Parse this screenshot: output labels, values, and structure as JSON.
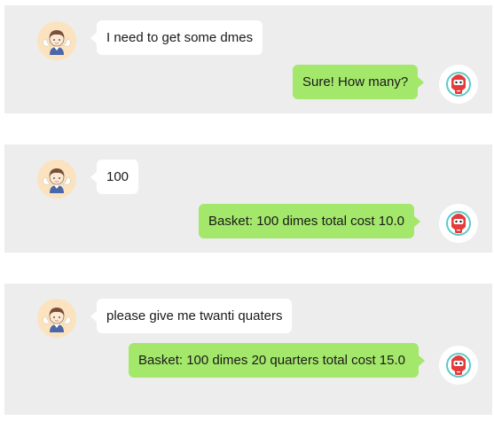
{
  "colors": {
    "panel_bg": "#ededed",
    "user_bubble": "#ffffff",
    "bot_bubble": "#a3e76b",
    "user_avatar_bg": "#fbe3bf"
  },
  "icons": {
    "user_avatar": "boy-with-wings-avatar-icon",
    "bot_avatar": "red-robot-avatar-icon"
  },
  "conversations": [
    {
      "user_message": "I need to get some dmes",
      "bot_message": "Sure! How many?"
    },
    {
      "user_message": "100",
      "bot_message": "Basket: 100 dimes total cost 10.0"
    },
    {
      "user_message": "please give me twanti quaters",
      "bot_message": "Basket: 100 dimes 20 quarters total cost 15.0"
    }
  ]
}
